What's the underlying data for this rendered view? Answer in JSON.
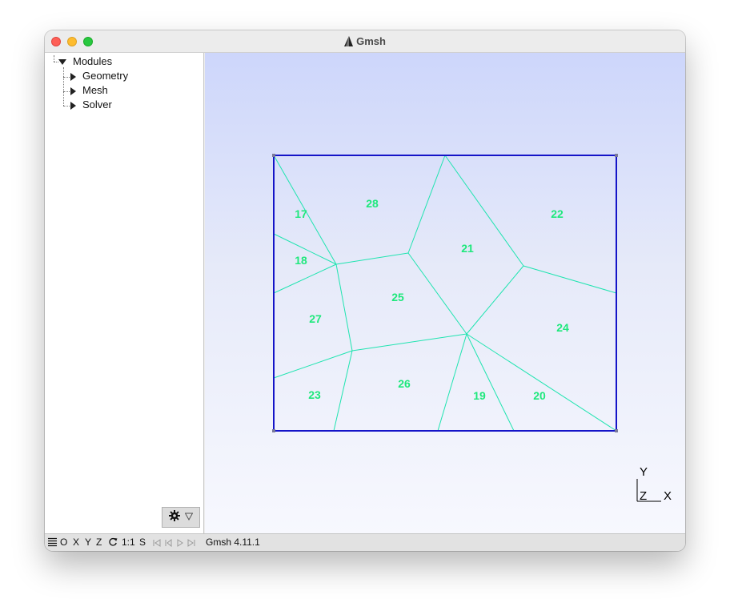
{
  "window": {
    "title": "Gmsh"
  },
  "tree": {
    "root": "Modules",
    "items": [
      {
        "label": "Geometry"
      },
      {
        "label": "Mesh"
      },
      {
        "label": "Solver"
      }
    ]
  },
  "mesh": {
    "boundary_color": "#1414c8",
    "edge_color": "#1fe4b0",
    "label_color": "#1ee87c",
    "labels": [
      "17",
      "28",
      "22",
      "18",
      "21",
      "25",
      "27",
      "24",
      "23",
      "26",
      "19",
      "20"
    ]
  },
  "axes": {
    "y": "Y",
    "z": "Z",
    "x": "X"
  },
  "statusbar": {
    "o": "O",
    "x": "X",
    "y": "Y",
    "z": "Z",
    "scale": "1:1",
    "s": "S",
    "version": "Gmsh 4.11.1"
  }
}
